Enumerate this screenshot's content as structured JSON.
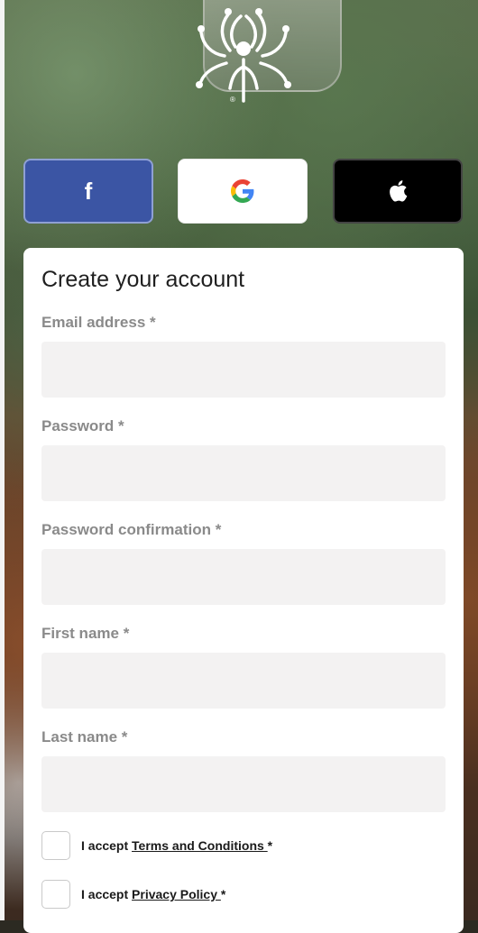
{
  "header": {
    "logo_icon": "special-olympics-logo-icon",
    "logo_mark": "®"
  },
  "social": {
    "facebook": {
      "label": "f",
      "icon": "facebook-icon",
      "color": "#3b55a4"
    },
    "google": {
      "icon": "google-icon"
    },
    "apple": {
      "icon": "apple-icon",
      "color": "#000000"
    }
  },
  "form": {
    "title": "Create your account",
    "fields": [
      {
        "label": "Email address *",
        "value": "",
        "placeholder": ""
      },
      {
        "label": "Password *",
        "value": "",
        "placeholder": ""
      },
      {
        "label": "Password confirmation *",
        "value": "",
        "placeholder": ""
      },
      {
        "label": "First name *",
        "value": "",
        "placeholder": ""
      },
      {
        "label": "Last name *",
        "value": "",
        "placeholder": ""
      }
    ],
    "checkboxes": [
      {
        "prefix": "I accept ",
        "link": "Terms and Conditions ",
        "suffix": "*",
        "checked": false
      },
      {
        "prefix": "I accept ",
        "link": "Privacy Policy ",
        "suffix": "*",
        "checked": false
      }
    ]
  },
  "colors": {
    "card": "#ffffff",
    "input_bg": "#f3f2f2",
    "label": "#8a8a8a"
  }
}
